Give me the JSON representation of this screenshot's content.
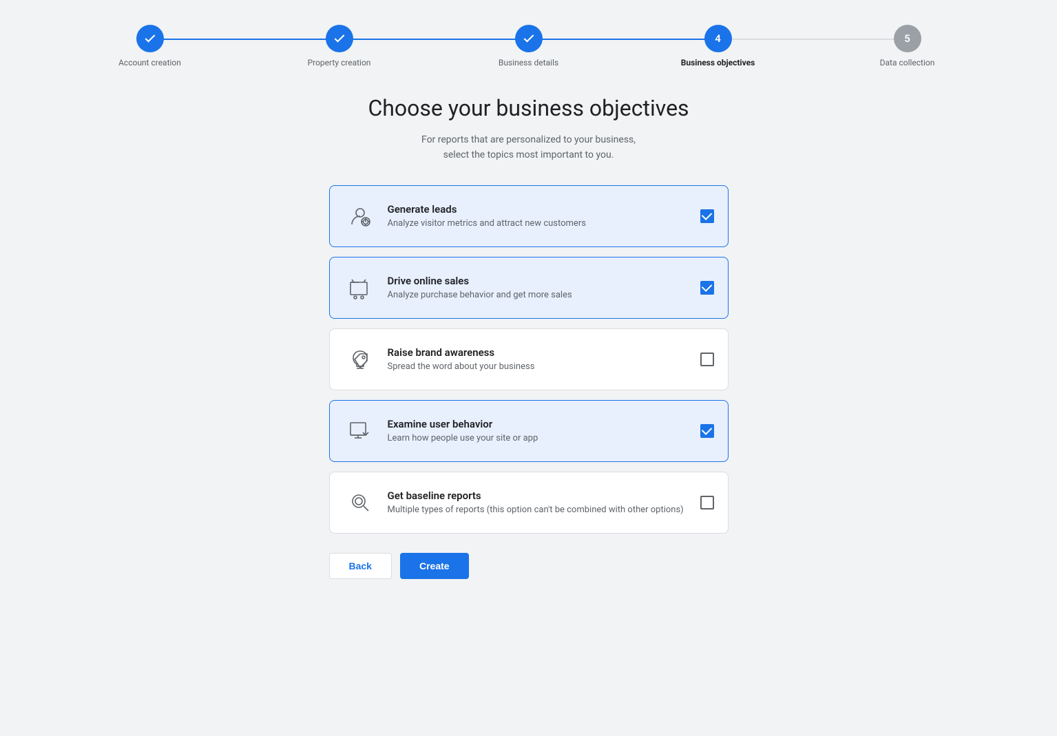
{
  "stepper": {
    "steps": [
      {
        "id": "account-creation",
        "label": "Account creation",
        "state": "completed",
        "display": "check"
      },
      {
        "id": "property-creation",
        "label": "Property creation",
        "state": "completed",
        "display": "check"
      },
      {
        "id": "business-details",
        "label": "Business details",
        "state": "completed",
        "display": "check"
      },
      {
        "id": "business-objectives",
        "label": "Business objectives",
        "state": "active",
        "display": "4"
      },
      {
        "id": "data-collection",
        "label": "Data collection",
        "state": "inactive",
        "display": "5"
      }
    ]
  },
  "page": {
    "title": "Choose your business objectives",
    "subtitle_line1": "For reports that are personalized to your business,",
    "subtitle_line2": "select the topics most important to you."
  },
  "options": [
    {
      "id": "generate-leads",
      "title": "Generate leads",
      "description": "Analyze visitor metrics and attract new customers",
      "selected": true,
      "icon": "leads-icon"
    },
    {
      "id": "drive-online-sales",
      "title": "Drive online sales",
      "description": "Analyze purchase behavior and get more sales",
      "selected": true,
      "icon": "sales-icon"
    },
    {
      "id": "raise-brand-awareness",
      "title": "Raise brand awareness",
      "description": "Spread the word about your business",
      "selected": false,
      "icon": "brand-icon"
    },
    {
      "id": "examine-user-behavior",
      "title": "Examine user behavior",
      "description": "Learn how people use your site or app",
      "selected": true,
      "icon": "behavior-icon"
    },
    {
      "id": "get-baseline-reports",
      "title": "Get baseline reports",
      "description": "Multiple types of reports (this option can't be combined with other options)",
      "selected": false,
      "icon": "baseline-icon"
    }
  ],
  "buttons": {
    "back_label": "Back",
    "create_label": "Create"
  }
}
